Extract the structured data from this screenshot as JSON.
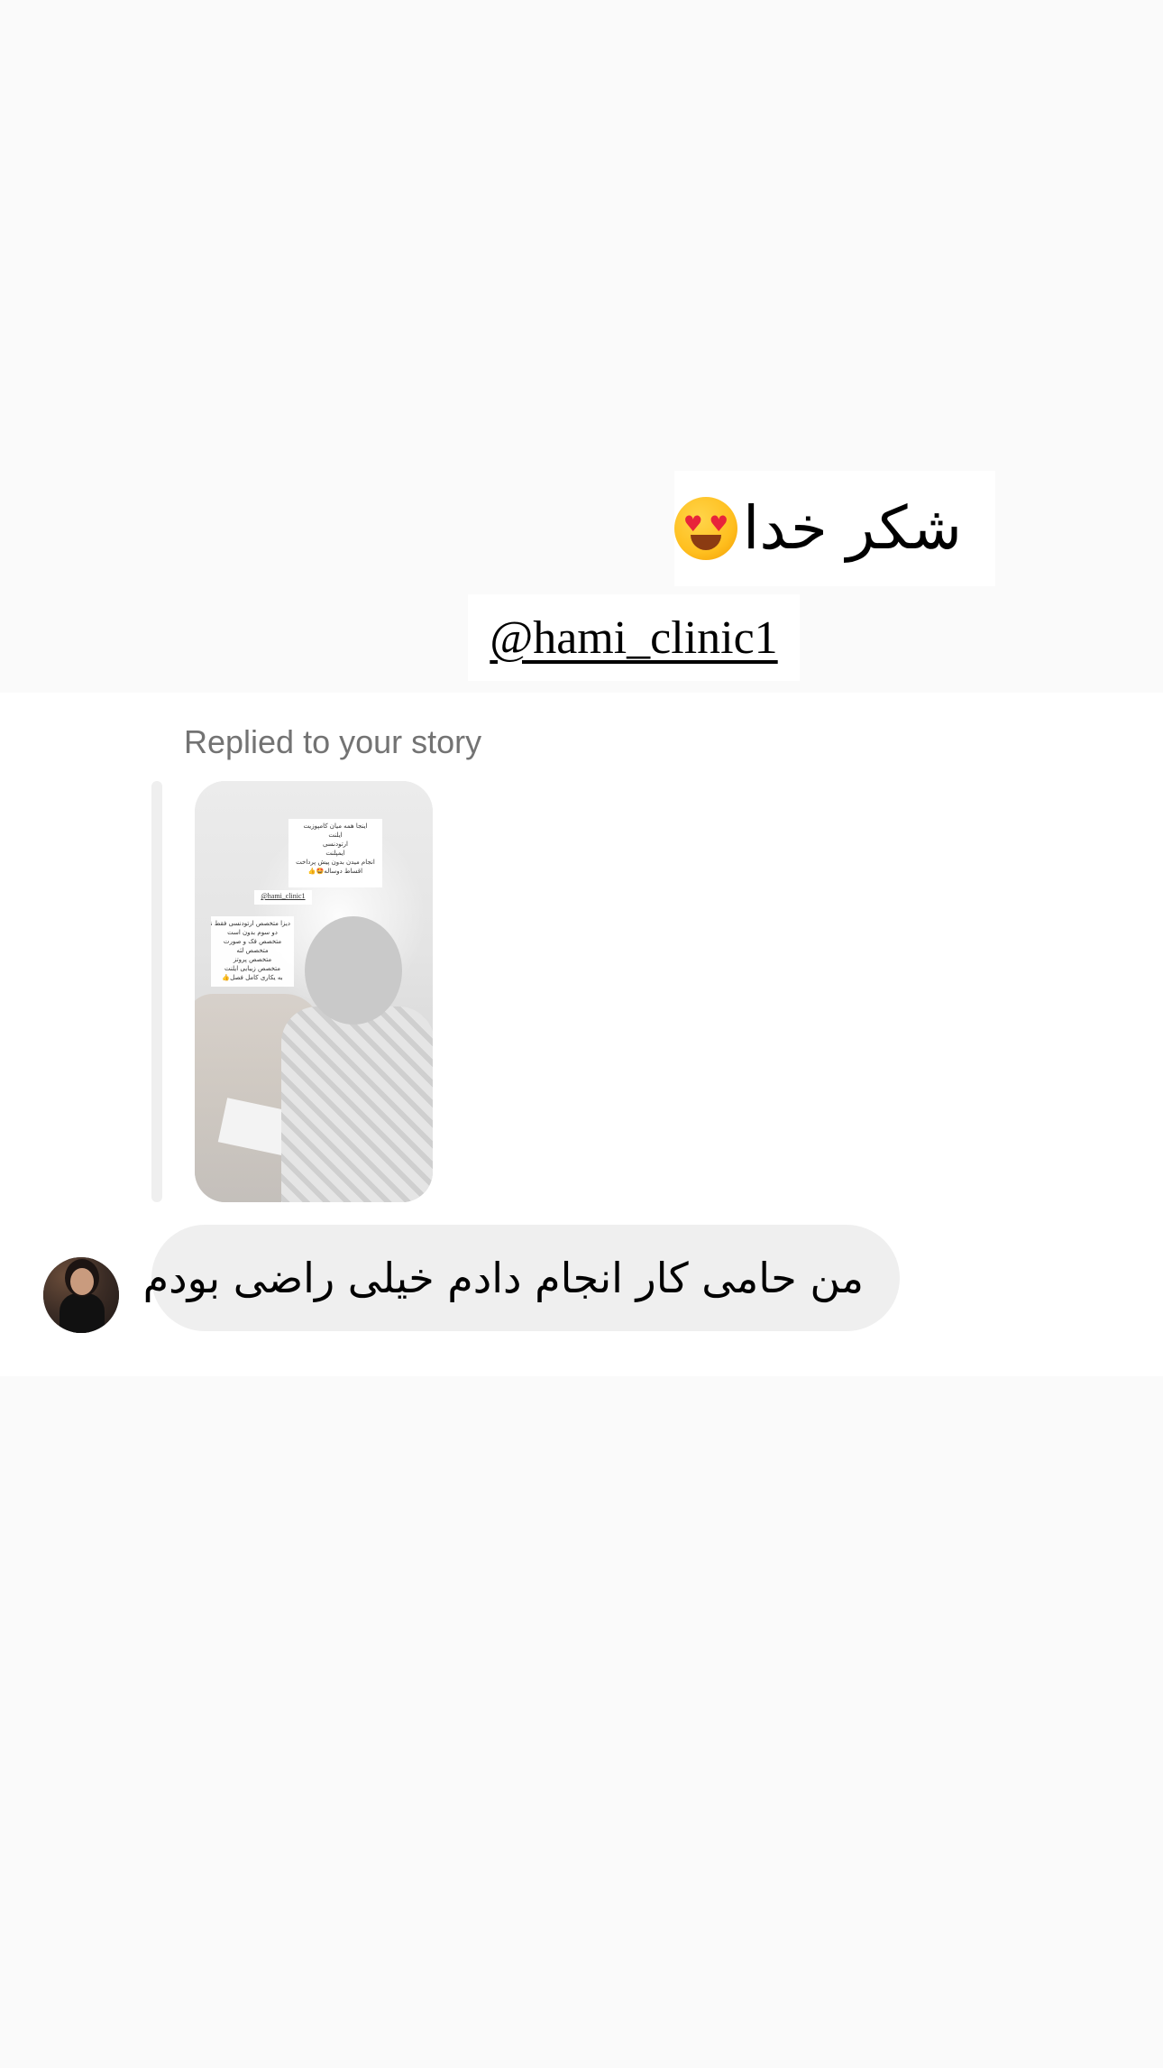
{
  "story_stickers": {
    "main_text": "شکر خدا",
    "main_emoji": "heart-eyes-emoji",
    "mention": "@hami_clinic1"
  },
  "reply": {
    "label": "Replied to your story",
    "thumbnail": {
      "note1_lines": [
        "اینجا همه میان کامپوزیت",
        "ایلنت",
        "ارتودنسی",
        "ایمپلنت",
        "انجام میدن بدون پیش پرداخت",
        "اقساط دوساله🤩👍"
      ],
      "note2": "@hami_clinic1",
      "note3_lines": [
        "دیزا متخصص ارتودنسی فقط نم",
        "دو سوم بدون است",
        "متخصص فک و صورت",
        "متخصص لثه",
        "متخصص پروتز",
        "متخصص زیبایی ایلنت",
        "به یکاری کامل فصل👍"
      ]
    }
  },
  "message": {
    "text": "من حامی کار انجام دادم خیلی راضی بودم"
  },
  "colors": {
    "page_bg": "#fafafa",
    "chat_bg": "#ffffff",
    "bubble_bg": "#efefef",
    "label_gray": "#737373"
  }
}
